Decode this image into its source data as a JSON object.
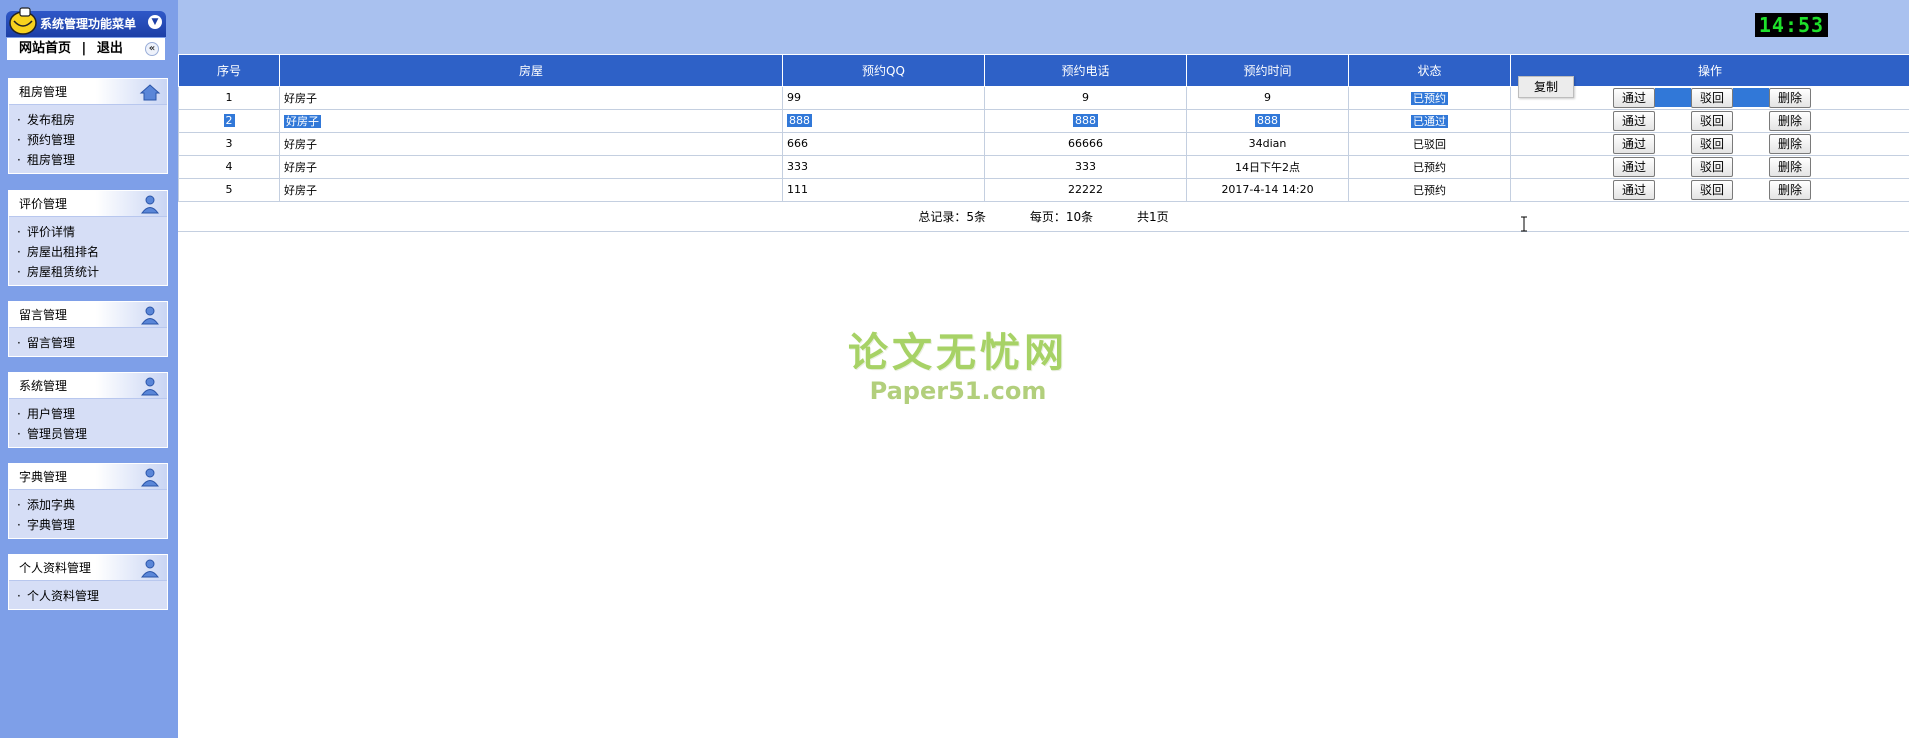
{
  "sidebar": {
    "title": "系统管理功能菜单",
    "links": {
      "home": "网站首页",
      "separator": "|",
      "logout": "退出"
    },
    "menus": [
      {
        "title": "租房管理",
        "items": [
          "发布租房",
          "预约管理",
          "租房管理"
        ]
      },
      {
        "title": "评价管理",
        "items": [
          "评价详情",
          "房屋出租排名",
          "房屋租赁统计"
        ]
      },
      {
        "title": "留言管理",
        "items": [
          "留言管理"
        ]
      },
      {
        "title": "系统管理",
        "items": [
          "用户管理",
          "管理员管理"
        ]
      },
      {
        "title": "字典管理",
        "items": [
          "添加字典",
          "字典管理"
        ]
      },
      {
        "title": "个人资料管理",
        "items": [
          "个人资料管理"
        ]
      }
    ],
    "bullet": "·"
  },
  "clock": "14:53",
  "table": {
    "headers": [
      "序号",
      "房屋",
      "预约QQ",
      "预约电话",
      "预约时间",
      "状态",
      "操作"
    ],
    "rows": [
      {
        "no": "1",
        "house": "好房子",
        "qq": "99",
        "phone": "9",
        "time": "9",
        "status": "已预约"
      },
      {
        "no": "2",
        "house": "好房子",
        "qq": "888",
        "phone": "888",
        "time": "888",
        "status": "已通过"
      },
      {
        "no": "3",
        "house": "好房子",
        "qq": "666",
        "phone": "66666",
        "time": "34dian",
        "status": "已驳回"
      },
      {
        "no": "4",
        "house": "好房子",
        "qq": "333",
        "phone": "333",
        "time": "14日下午2点",
        "status": "已预约"
      },
      {
        "no": "5",
        "house": "好房子",
        "qq": "111",
        "phone": "22222",
        "time": "2017-4-14 14:20",
        "status": "已预约"
      }
    ],
    "actions": {
      "approve": "通过",
      "reject": "驳回",
      "delete": "删除"
    }
  },
  "pager": {
    "total": "总记录：5条",
    "per_page": "每页：10条",
    "pages": "共1页"
  },
  "copy_popup": "复制",
  "watermark": {
    "cn": "论文无忧网",
    "en": "Paper51.com"
  }
}
